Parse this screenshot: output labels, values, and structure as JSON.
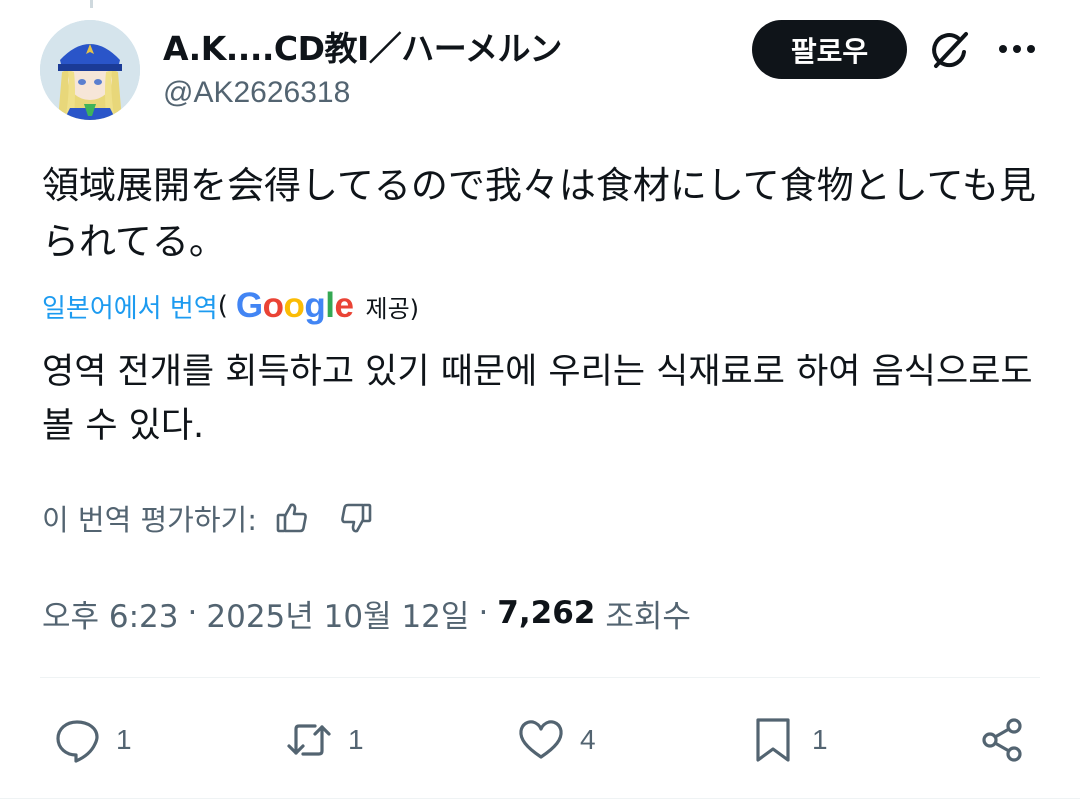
{
  "author": {
    "display_name": "A.K....CD教I／ハーメルン",
    "handle": "@AK2626318"
  },
  "header": {
    "follow_label": "팔로우",
    "grok_icon": "grok-icon",
    "more_icon": "more-icon"
  },
  "tweet": {
    "text": "領域展開を会得してるので我々は食材にして食物としても見られてる。"
  },
  "translation": {
    "link_label": "일본어에서 번역",
    "paren_open": "(",
    "provider_logo": "Google",
    "provided_label": "제공)",
    "text": "영역 전개를 회득하고 있기 때문에 우리는 식재료로 하여 음식으로도 볼 수 있다.",
    "rate_label": "이 번역 평가하기:",
    "thumbs_up_icon": "thumbs-up-icon",
    "thumbs_down_icon": "thumbs-down-icon"
  },
  "meta": {
    "time": "오후 6:23",
    "separator": "·",
    "date": "2025년 10월 12일",
    "views_count": "7,262",
    "views_label": "조회수"
  },
  "actions": {
    "reply": {
      "icon": "reply-icon",
      "count": "1"
    },
    "retweet": {
      "icon": "retweet-icon",
      "count": "1"
    },
    "like": {
      "icon": "heart-icon",
      "count": "4"
    },
    "bookmark": {
      "icon": "bookmark-icon",
      "count": "1"
    },
    "share": {
      "icon": "share-icon"
    }
  },
  "colors": {
    "text": "#0f1419",
    "secondary": "#536471",
    "link": "#1d9bf0",
    "follow_bg": "#0f1419"
  }
}
